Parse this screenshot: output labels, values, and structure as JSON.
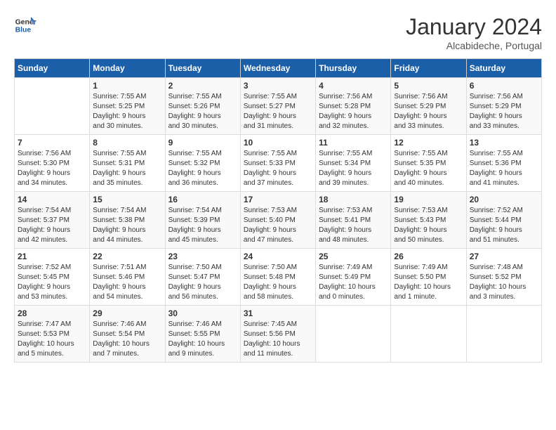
{
  "header": {
    "logo_line1": "General",
    "logo_line2": "Blue",
    "month": "January 2024",
    "location": "Alcabideche, Portugal"
  },
  "weekdays": [
    "Sunday",
    "Monday",
    "Tuesday",
    "Wednesday",
    "Thursday",
    "Friday",
    "Saturday"
  ],
  "weeks": [
    [
      {
        "day": "",
        "info": ""
      },
      {
        "day": "1",
        "info": "Sunrise: 7:55 AM\nSunset: 5:25 PM\nDaylight: 9 hours\nand 30 minutes."
      },
      {
        "day": "2",
        "info": "Sunrise: 7:55 AM\nSunset: 5:26 PM\nDaylight: 9 hours\nand 30 minutes."
      },
      {
        "day": "3",
        "info": "Sunrise: 7:55 AM\nSunset: 5:27 PM\nDaylight: 9 hours\nand 31 minutes."
      },
      {
        "day": "4",
        "info": "Sunrise: 7:56 AM\nSunset: 5:28 PM\nDaylight: 9 hours\nand 32 minutes."
      },
      {
        "day": "5",
        "info": "Sunrise: 7:56 AM\nSunset: 5:29 PM\nDaylight: 9 hours\nand 33 minutes."
      },
      {
        "day": "6",
        "info": "Sunrise: 7:56 AM\nSunset: 5:29 PM\nDaylight: 9 hours\nand 33 minutes."
      }
    ],
    [
      {
        "day": "7",
        "info": "Sunrise: 7:56 AM\nSunset: 5:30 PM\nDaylight: 9 hours\nand 34 minutes."
      },
      {
        "day": "8",
        "info": "Sunrise: 7:55 AM\nSunset: 5:31 PM\nDaylight: 9 hours\nand 35 minutes."
      },
      {
        "day": "9",
        "info": "Sunrise: 7:55 AM\nSunset: 5:32 PM\nDaylight: 9 hours\nand 36 minutes."
      },
      {
        "day": "10",
        "info": "Sunrise: 7:55 AM\nSunset: 5:33 PM\nDaylight: 9 hours\nand 37 minutes."
      },
      {
        "day": "11",
        "info": "Sunrise: 7:55 AM\nSunset: 5:34 PM\nDaylight: 9 hours\nand 39 minutes."
      },
      {
        "day": "12",
        "info": "Sunrise: 7:55 AM\nSunset: 5:35 PM\nDaylight: 9 hours\nand 40 minutes."
      },
      {
        "day": "13",
        "info": "Sunrise: 7:55 AM\nSunset: 5:36 PM\nDaylight: 9 hours\nand 41 minutes."
      }
    ],
    [
      {
        "day": "14",
        "info": "Sunrise: 7:54 AM\nSunset: 5:37 PM\nDaylight: 9 hours\nand 42 minutes."
      },
      {
        "day": "15",
        "info": "Sunrise: 7:54 AM\nSunset: 5:38 PM\nDaylight: 9 hours\nand 44 minutes."
      },
      {
        "day": "16",
        "info": "Sunrise: 7:54 AM\nSunset: 5:39 PM\nDaylight: 9 hours\nand 45 minutes."
      },
      {
        "day": "17",
        "info": "Sunrise: 7:53 AM\nSunset: 5:40 PM\nDaylight: 9 hours\nand 47 minutes."
      },
      {
        "day": "18",
        "info": "Sunrise: 7:53 AM\nSunset: 5:41 PM\nDaylight: 9 hours\nand 48 minutes."
      },
      {
        "day": "19",
        "info": "Sunrise: 7:53 AM\nSunset: 5:43 PM\nDaylight: 9 hours\nand 50 minutes."
      },
      {
        "day": "20",
        "info": "Sunrise: 7:52 AM\nSunset: 5:44 PM\nDaylight: 9 hours\nand 51 minutes."
      }
    ],
    [
      {
        "day": "21",
        "info": "Sunrise: 7:52 AM\nSunset: 5:45 PM\nDaylight: 9 hours\nand 53 minutes."
      },
      {
        "day": "22",
        "info": "Sunrise: 7:51 AM\nSunset: 5:46 PM\nDaylight: 9 hours\nand 54 minutes."
      },
      {
        "day": "23",
        "info": "Sunrise: 7:50 AM\nSunset: 5:47 PM\nDaylight: 9 hours\nand 56 minutes."
      },
      {
        "day": "24",
        "info": "Sunrise: 7:50 AM\nSunset: 5:48 PM\nDaylight: 9 hours\nand 58 minutes."
      },
      {
        "day": "25",
        "info": "Sunrise: 7:49 AM\nSunset: 5:49 PM\nDaylight: 10 hours\nand 0 minutes."
      },
      {
        "day": "26",
        "info": "Sunrise: 7:49 AM\nSunset: 5:50 PM\nDaylight: 10 hours\nand 1 minute."
      },
      {
        "day": "27",
        "info": "Sunrise: 7:48 AM\nSunset: 5:52 PM\nDaylight: 10 hours\nand 3 minutes."
      }
    ],
    [
      {
        "day": "28",
        "info": "Sunrise: 7:47 AM\nSunset: 5:53 PM\nDaylight: 10 hours\nand 5 minutes."
      },
      {
        "day": "29",
        "info": "Sunrise: 7:46 AM\nSunset: 5:54 PM\nDaylight: 10 hours\nand 7 minutes."
      },
      {
        "day": "30",
        "info": "Sunrise: 7:46 AM\nSunset: 5:55 PM\nDaylight: 10 hours\nand 9 minutes."
      },
      {
        "day": "31",
        "info": "Sunrise: 7:45 AM\nSunset: 5:56 PM\nDaylight: 10 hours\nand 11 minutes."
      },
      {
        "day": "",
        "info": ""
      },
      {
        "day": "",
        "info": ""
      },
      {
        "day": "",
        "info": ""
      }
    ]
  ]
}
